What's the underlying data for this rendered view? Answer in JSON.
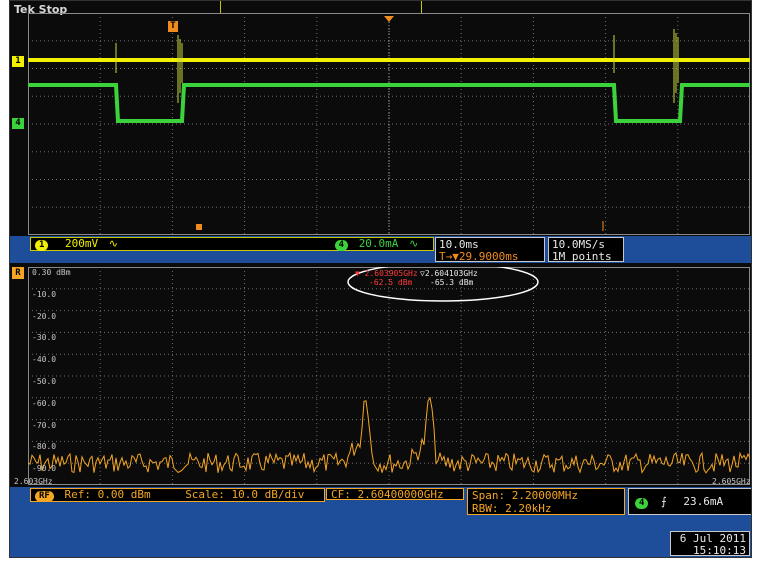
{
  "header": {
    "title": "Tek Stop",
    "trigger_marker": "T"
  },
  "channels": {
    "ch1": {
      "id": "1",
      "label": "200mV",
      "coupling": "∿",
      "color": "#f0f000"
    },
    "ch4": {
      "id": "4",
      "label": "20.0mA",
      "coupling": "∿",
      "color": "#3cd23c"
    },
    "rf": {
      "id": "R",
      "color": "#f5a623"
    }
  },
  "timebase": {
    "scale": "10.0ms",
    "trigger_pos": "T→▼29.9000ms",
    "sample_rate": "10.0MS/s",
    "record_length": "1M points"
  },
  "freq_domain": {
    "ylabels": [
      "0.30 dBm",
      "-10.0",
      "-20.0",
      "-30.0",
      "-40.0",
      "-50.0",
      "-60.0",
      "-70.0",
      "-80.0",
      "-90.0"
    ],
    "x_left": "2.603GHz",
    "x_right": "2.605GHz",
    "marker_a": {
      "freq": "2.603905GHz",
      "level": "-62.5 dBm"
    },
    "marker_b": {
      "freq": "2.604103GHz",
      "level": "-65.3 dBm"
    }
  },
  "status_bar": {
    "rf_badge": "RF",
    "ref": "Ref: 0.00 dBm",
    "scale": "Scale: 10.0 dB/div",
    "cf": "CF: 2.60400000GHz",
    "span": "Span:  2.20000MHz",
    "rbw": "RBW:   2.20kHz",
    "trig_ch": "4",
    "trig_slope": "⨍",
    "trig_level": "23.6mA"
  },
  "datetime": {
    "date": "6 Jul 2011",
    "time": "15:10:13"
  }
}
